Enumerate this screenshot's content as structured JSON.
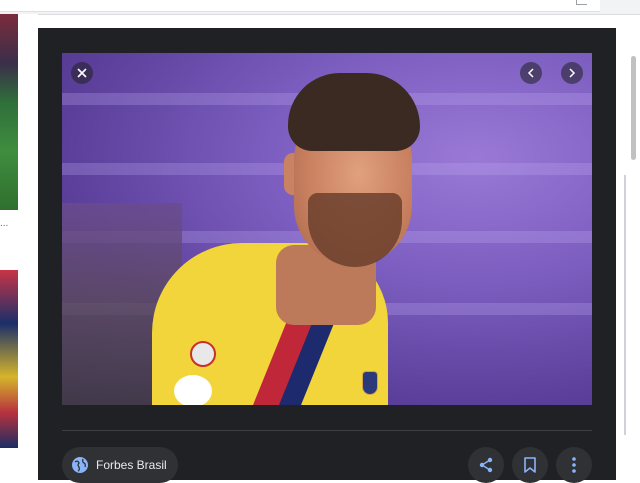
{
  "results": [
    {
      "caption": "..."
    },
    {
      "caption": ""
    }
  ],
  "viewer": {
    "close_icon": "close-icon",
    "prev_icon": "chevron-left-icon",
    "next_icon": "chevron-right-icon",
    "image": {
      "subject": "photo",
      "alt": ""
    },
    "source": {
      "label": "Forbes Brasil",
      "icon": "globe-icon"
    },
    "actions": [
      {
        "icon": "share-icon"
      },
      {
        "icon": "bookmark-icon"
      },
      {
        "icon": "more-vertical-icon"
      }
    ]
  },
  "colors": {
    "panel_bg": "#202124",
    "chip_bg": "#303134",
    "icon_blue": "#8ab4f8",
    "text_light": "#e8eaed"
  }
}
